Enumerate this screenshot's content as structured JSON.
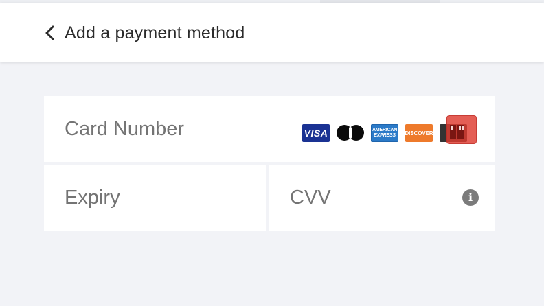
{
  "header": {
    "back_icon": "chevron-left-icon",
    "title": "Add a payment method"
  },
  "form": {
    "card_number": {
      "placeholder": "Card Number",
      "value": ""
    },
    "expiry": {
      "placeholder": "Expiry",
      "value": ""
    },
    "cvv": {
      "placeholder": "CVV",
      "value": "",
      "info_icon": "info-icon"
    },
    "card_brands": [
      {
        "name": "visa",
        "label": "VISA",
        "color": "#1a3293"
      },
      {
        "name": "mastercard",
        "label": "",
        "color": "#0a0a0a"
      },
      {
        "name": "amex",
        "label_top": "AMERICAN",
        "label_bottom": "EXPRESS",
        "color": "#2b7ac8"
      },
      {
        "name": "discover",
        "label": "DISCOVER",
        "color": "#ee7a2b"
      },
      {
        "name": "generic-card",
        "label": "",
        "color": "#333333"
      }
    ]
  },
  "colors": {
    "background": "#f2f3f7",
    "surface": "#ffffff",
    "placeholder_text": "#747474",
    "title_text": "#2b2b2b",
    "info_icon": "#7b7b7b",
    "highlight_overlay": "#de3a30"
  }
}
